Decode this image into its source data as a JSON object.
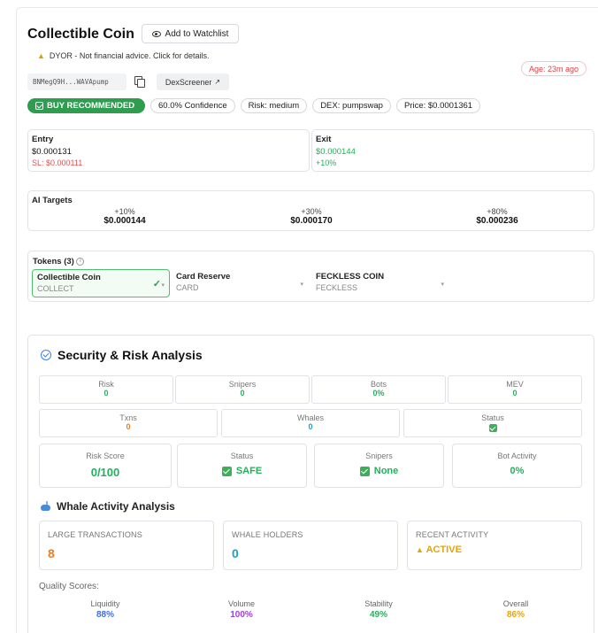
{
  "header": {
    "title": "Collectible Coin",
    "watch_label": "Add to Watchlist",
    "dyor": "DYOR - Not financial advice. Click for details.",
    "age": "Age: 23m ago",
    "address": "BNMegQ9H...WAVApump",
    "dexscreener": "DexScreener"
  },
  "pills": {
    "recommendation": "BUY RECOMMENDED",
    "confidence": "60.0% Confidence",
    "risk": "Risk: medium",
    "dex": "DEX: pumpswap",
    "price": "Price: $0.0001361"
  },
  "entry": {
    "label": "Entry",
    "price": "$0.000131",
    "sl": "SL: $0.000111"
  },
  "exit": {
    "label": "Exit",
    "price": "$0.000144",
    "pct": "+10%"
  },
  "ai_targets": {
    "label": "AI Targets",
    "items": [
      {
        "pct": "+10%",
        "price": "$0.000144"
      },
      {
        "pct": "+30%",
        "price": "$0.000170"
      },
      {
        "pct": "+80%",
        "price": "$0.000236"
      }
    ]
  },
  "tokens": {
    "label": "Tokens (3)",
    "items": [
      {
        "name": "Collectible Coin",
        "symbol": "COLLECT"
      },
      {
        "name": "Card Reserve",
        "symbol": "CARD"
      },
      {
        "name": "FECKLESS COIN",
        "symbol": "FECKLESS"
      }
    ]
  },
  "security": {
    "title": "Security & Risk Analysis",
    "row1": [
      {
        "label": "Risk",
        "value": "0"
      },
      {
        "label": "Snipers",
        "value": "0"
      },
      {
        "label": "Bots",
        "value": "0%"
      },
      {
        "label": "MEV",
        "value": "0"
      }
    ],
    "row2": [
      {
        "label": "Txns",
        "value": "0"
      },
      {
        "label": "Whales",
        "value": "0"
      },
      {
        "label": "Status",
        "value": ""
      }
    ],
    "cards": [
      {
        "label": "Risk Score",
        "value": "0/100"
      },
      {
        "label": "Status",
        "value": "SAFE"
      },
      {
        "label": "Snipers",
        "value": "None"
      },
      {
        "label": "Bot Activity",
        "value": "0%"
      }
    ]
  },
  "whale": {
    "title": "Whale Activity Analysis",
    "boxes": [
      {
        "label": "LARGE TRANSACTIONS",
        "value": "8"
      },
      {
        "label": "WHALE HOLDERS",
        "value": "0"
      },
      {
        "label": "RECENT ACTIVITY",
        "value": "ACTIVE"
      }
    ]
  },
  "quality": {
    "label": "Quality Scores:",
    "items": [
      {
        "label": "Liquidity",
        "value": "88%",
        "color": "#3b6fe0"
      },
      {
        "label": "Volume",
        "value": "100%",
        "color": "#a33de0"
      },
      {
        "label": "Stability",
        "value": "49%",
        "color": "#22b05b"
      },
      {
        "label": "Overall",
        "value": "86%",
        "color": "#e8a400"
      }
    ]
  }
}
